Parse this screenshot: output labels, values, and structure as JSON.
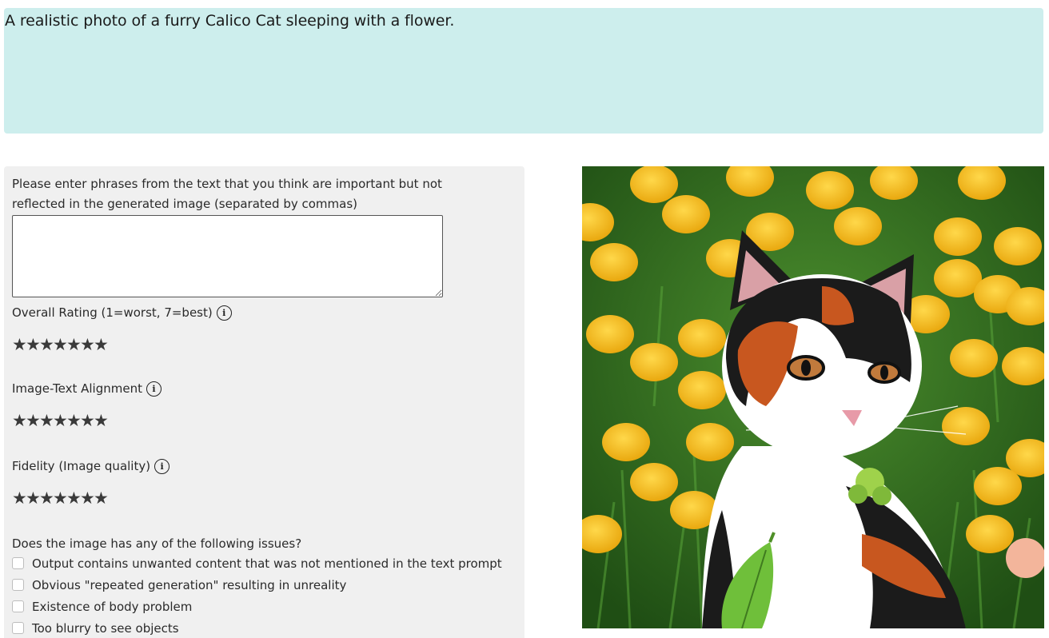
{
  "prompt": {
    "text": "A realistic photo of a furry Calico Cat sleeping with a flower."
  },
  "form": {
    "instruction": "Please enter phrases from the text that you think are important but not reflected in the generated image (separated by commas)",
    "phrases_value": "",
    "ratings": [
      {
        "label": "Overall Rating (1=worst, 7=best)",
        "stars": 7
      },
      {
        "label": "Image-Text Alignment",
        "stars": 7
      },
      {
        "label": "Fidelity (Image quality)",
        "stars": 7
      }
    ],
    "issues_question": "Does the image has any of the following issues?",
    "issues": [
      "Output contains unwanted content that was not mentioned in the text prompt",
      "Obvious \"repeated generation\" resulting in unreality",
      "Existence of body problem",
      "Too blurry to see objects"
    ],
    "info_glyph": "i",
    "star_glyph": "★"
  },
  "image": {
    "subject": "calico-cat-photo"
  },
  "colors": {
    "prompt_bg": "#cdeeed",
    "panel_bg": "#f0f0f0",
    "flower_yellow": "#f6bf1c",
    "grass_green": "#3d7d24"
  }
}
